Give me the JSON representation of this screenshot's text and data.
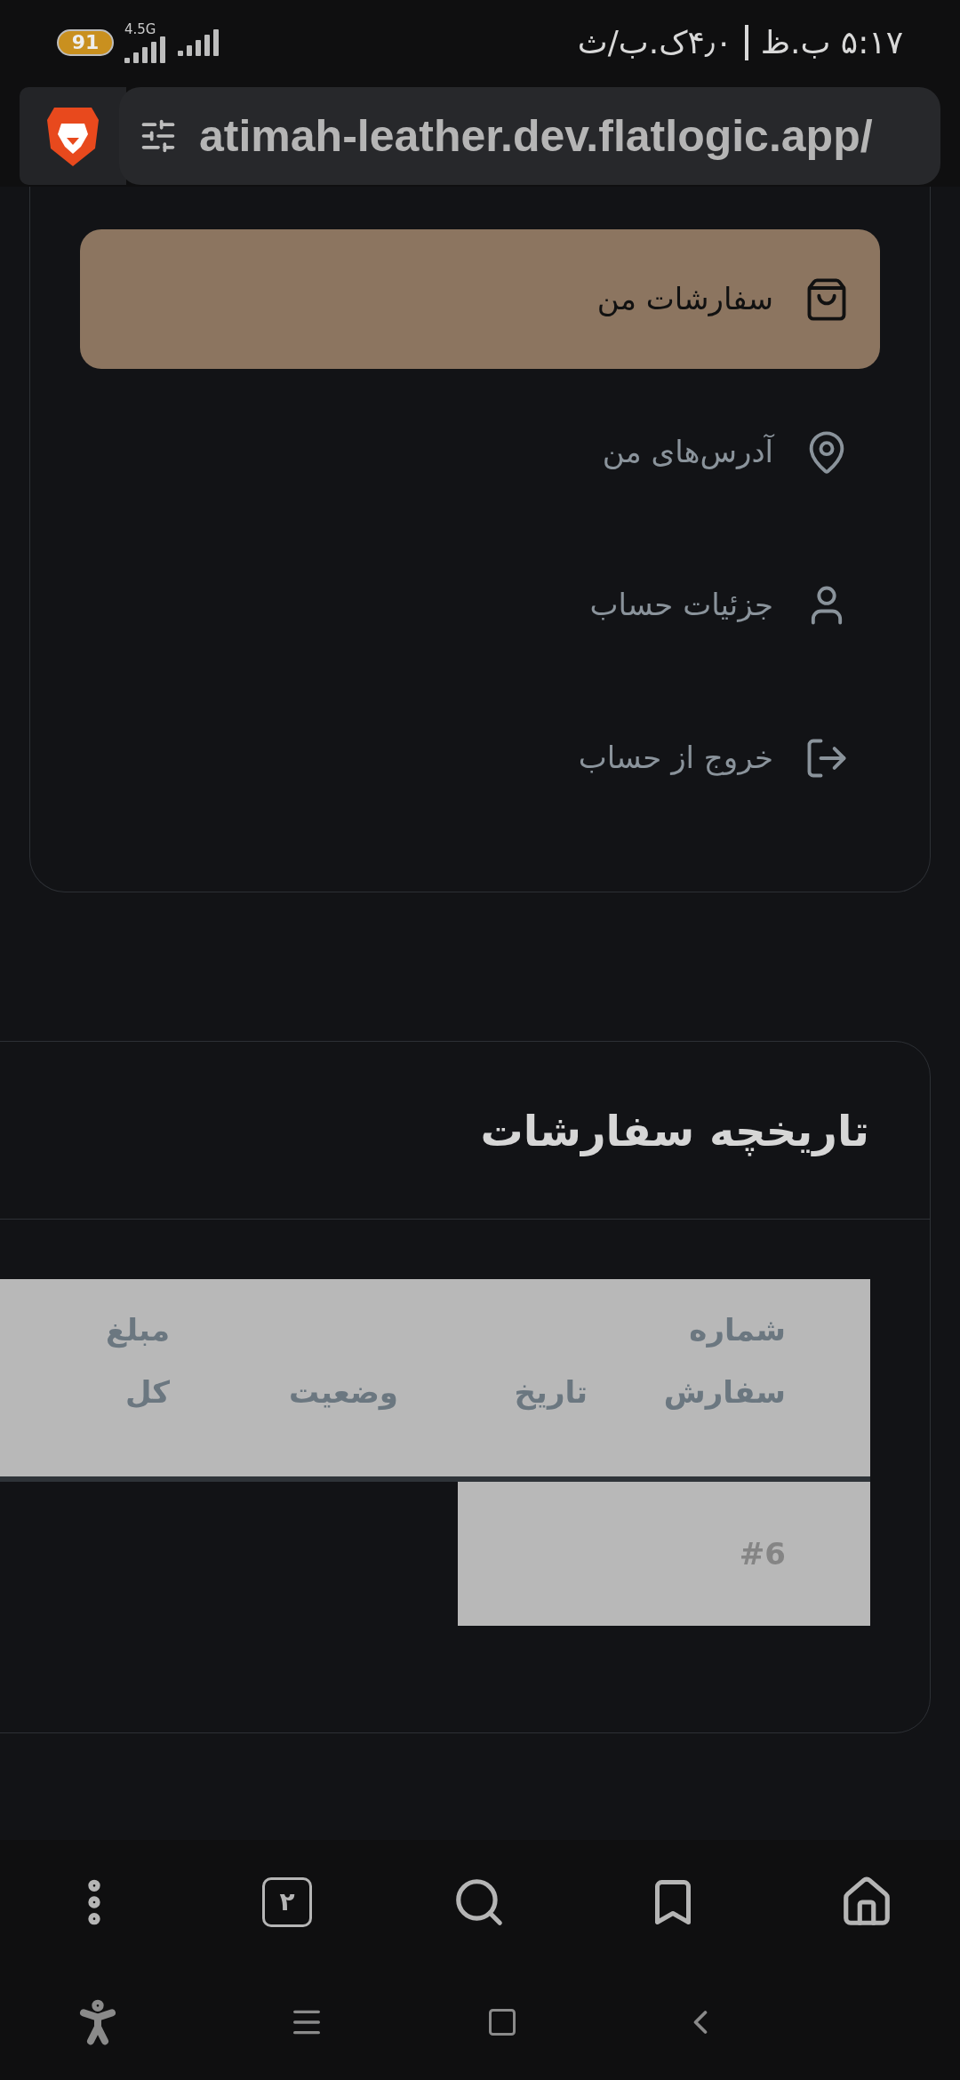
{
  "status_bar": {
    "battery": "91",
    "network": "4.5G",
    "time": "۵:۱۷ ب.ظ",
    "network_speed": "۴٫۰ک.ب/ث"
  },
  "browser": {
    "url": "atimah-leather.dev.flatlogic.app/",
    "tab_count": "۲"
  },
  "account_menu": {
    "items": [
      {
        "label": "سفارشات من",
        "kind": "bag",
        "selected": true
      },
      {
        "label": "آدرس‌های من",
        "kind": "pin",
        "selected": false
      },
      {
        "label": "جزئیات حساب",
        "kind": "user",
        "selected": false
      },
      {
        "label": "خروج از حساب",
        "kind": "logout",
        "selected": false
      }
    ]
  },
  "order_history": {
    "title": "تاریخچه سفارشات",
    "table": {
      "columns": [
        "شماره سفارش",
        "تاریخ",
        "وضعیت",
        "مبلغ کل"
      ],
      "rows": [
        [
          "#6"
        ]
      ]
    }
  }
}
